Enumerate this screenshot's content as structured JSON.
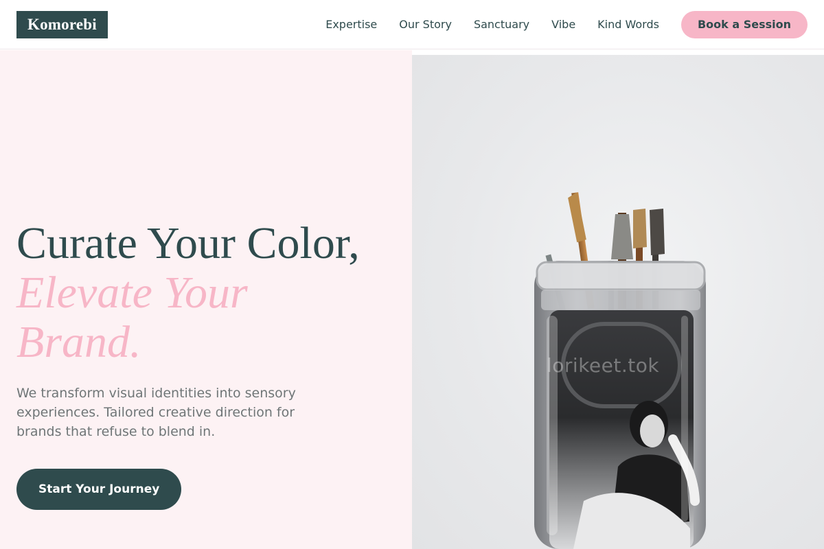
{
  "brand": {
    "name": "Komorebi"
  },
  "nav": {
    "links": [
      "Expertise",
      "Our Story",
      "Sanctuary",
      "Vibe",
      "Kind Words"
    ],
    "cta_label": "Book a Session"
  },
  "hero": {
    "headline_line1": "Curate Your Color,",
    "headline_accent": "Elevate Your Brand.",
    "subtext": "We transform visual identities into sensory experiences. Tailored creative direction for brands that refuse to blend in.",
    "primary_button_label": "Start Your Journey",
    "image_watermark": "lorikeet.tok"
  },
  "colors": {
    "brand_dark": "#2f4b4d",
    "accent_pink": "#f7b6c7",
    "hero_bg": "#fdf2f4",
    "body_text": "#6f7677"
  }
}
